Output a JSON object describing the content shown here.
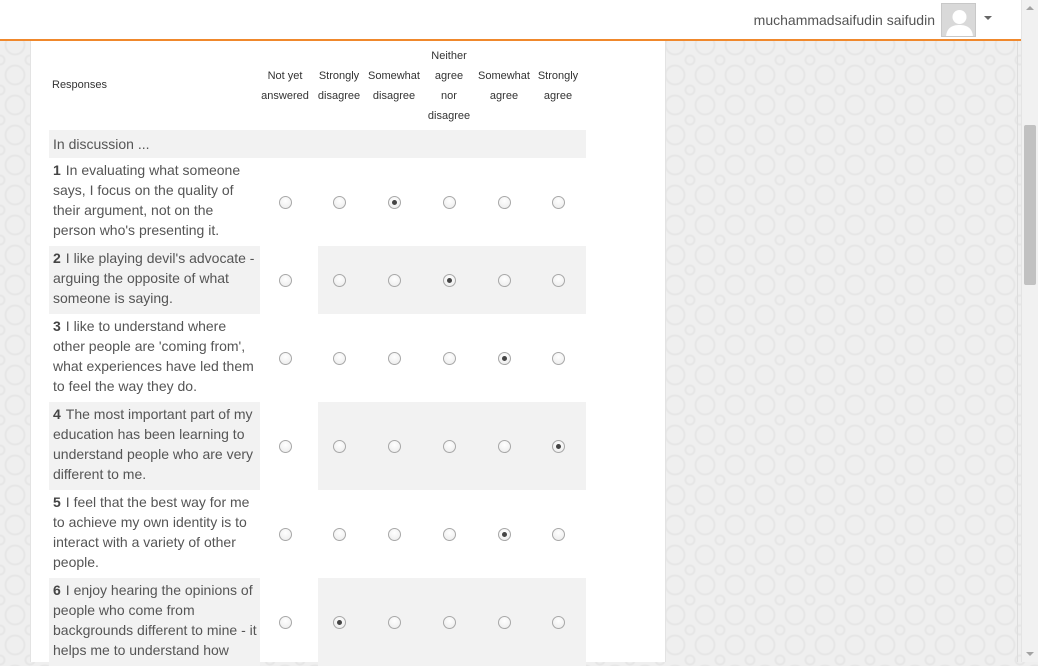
{
  "header": {
    "user_name": "muchammadsaifudin saifudin",
    "avatar_icon": "avatar-icon",
    "dropdown_icon": "caret-down-icon",
    "accent_color": "#f0882c"
  },
  "survey": {
    "responses_label": "Responses",
    "columns": [
      [
        "Not yet",
        "answered"
      ],
      [
        "Strongly",
        "disagree"
      ],
      [
        "Somewhat",
        "disagree"
      ],
      [
        "Neither",
        "agree",
        "nor",
        "disagree"
      ],
      [
        "Somewhat",
        "agree"
      ],
      [
        "Strongly",
        "agree"
      ]
    ],
    "section_label": "In discussion ...",
    "questions": [
      {
        "num": "1",
        "text": "In evaluating what someone says, I focus on the quality of their argument, not on the person who's presenting it.",
        "selected": 2
      },
      {
        "num": "2",
        "text": "I like playing devil's advocate - arguing the opposite of what someone is saying.",
        "selected": 3
      },
      {
        "num": "3",
        "text": "I like to understand where other people are 'coming from', what experiences have led them to feel the way they do.",
        "selected": 4
      },
      {
        "num": "4",
        "text": "The most important part of my education has been learning to understand people who are very different to me.",
        "selected": 5
      },
      {
        "num": "5",
        "text": "I feel that the best way for me to achieve my own identity is to interact with a variety of other people.",
        "selected": 4
      },
      {
        "num": "6",
        "text": "I enjoy hearing the opinions of people who come from backgrounds different to mine - it helps me to understand how",
        "selected": 1
      }
    ]
  }
}
